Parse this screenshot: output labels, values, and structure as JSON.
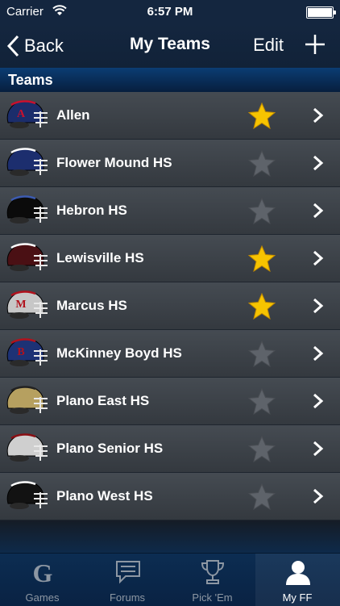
{
  "status_bar": {
    "carrier": "Carrier",
    "time": "6:57 PM"
  },
  "nav": {
    "back_label": "Back",
    "title": "My Teams",
    "edit_label": "Edit"
  },
  "section": {
    "header": "Teams"
  },
  "teams": [
    {
      "name": "Allen",
      "favorite": true,
      "helmet": "#1b2d6b",
      "trim": "#c8102e",
      "letter": "A"
    },
    {
      "name": "Flower Mound HS",
      "favorite": false,
      "helmet": "#1c2e6e",
      "trim": "#ffffff",
      "letter": ""
    },
    {
      "name": "Hebron HS",
      "favorite": false,
      "helmet": "#0b0b0b",
      "trim": "#3c5bb0",
      "letter": ""
    },
    {
      "name": "Lewisville HS",
      "favorite": true,
      "helmet": "#4a1014",
      "trim": "#ffffff",
      "letter": ""
    },
    {
      "name": "Marcus HS",
      "favorite": true,
      "helmet": "#c7c7c7",
      "trim": "#b1121d",
      "letter": "M"
    },
    {
      "name": "McKinney Boyd HS",
      "favorite": false,
      "helmet": "#1d3275",
      "trim": "#b1121d",
      "letter": "B"
    },
    {
      "name": "Plano East HS",
      "favorite": false,
      "helmet": "#b6a060",
      "trim": "#222222",
      "letter": ""
    },
    {
      "name": "Plano Senior HS",
      "favorite": false,
      "helmet": "#cfcfcf",
      "trim": "#8a0f14",
      "letter": ""
    },
    {
      "name": "Plano West HS",
      "favorite": false,
      "helmet": "#121212",
      "trim": "#ffffff",
      "letter": ""
    }
  ],
  "colors": {
    "star_on": "#f7c400",
    "star_off": "#5e636a"
  },
  "tabs": [
    {
      "label": "Games",
      "icon": "g-logo-icon",
      "active": false
    },
    {
      "label": "Forums",
      "icon": "chat-bubble-icon",
      "active": false
    },
    {
      "label": "Pick 'Em",
      "icon": "trophy-icon",
      "active": false
    },
    {
      "label": "My FF",
      "icon": "person-icon",
      "active": true
    }
  ]
}
